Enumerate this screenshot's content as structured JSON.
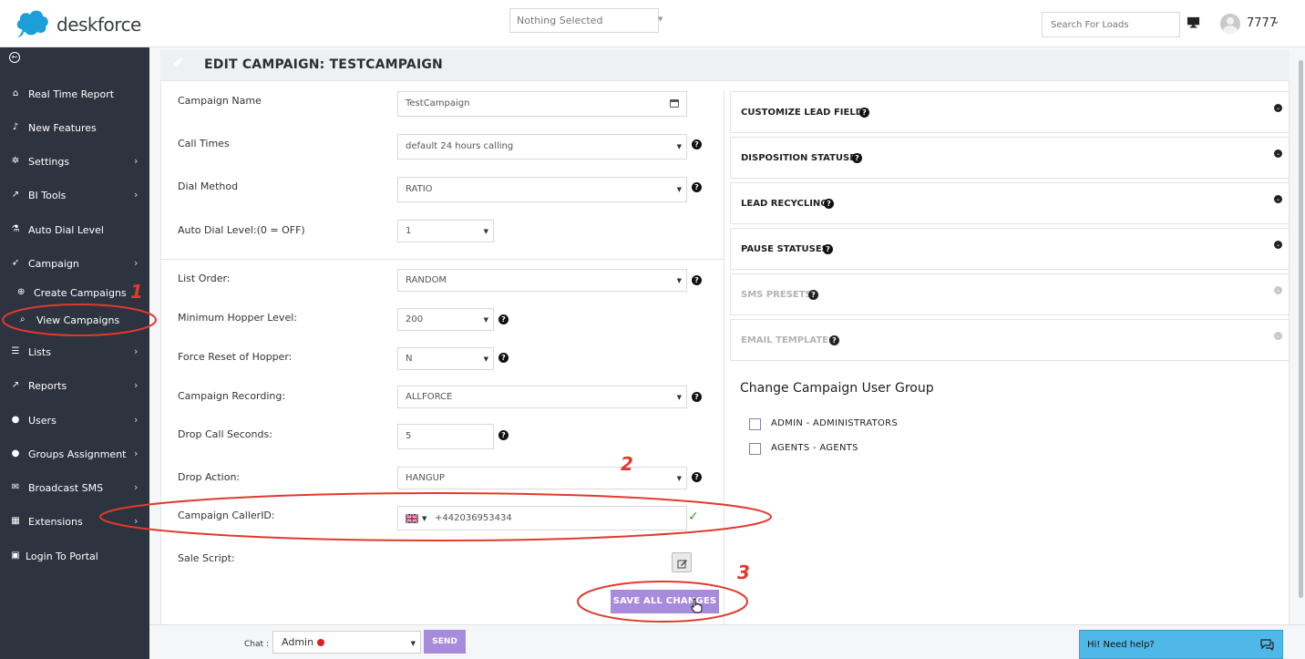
{
  "app": {
    "logo_text": "deskforce"
  },
  "header": {
    "campaign_select": "Nothing Selected",
    "search_placeholder": "Search For Loads",
    "user_name": "7777"
  },
  "sidebar": {
    "items": [
      {
        "label": "Real Time Report",
        "icon": "home-icon"
      },
      {
        "label": "New Features",
        "icon": "bell-icon"
      },
      {
        "label": "Settings",
        "icon": "gear-icon"
      },
      {
        "label": "BI Tools",
        "icon": "chart-line-icon"
      },
      {
        "label": "Auto Dial Level",
        "icon": "flask-icon"
      },
      {
        "label": "Campaign",
        "icon": "rocket-icon"
      },
      {
        "label": "Lists",
        "icon": "list-icon"
      },
      {
        "label": "Reports",
        "icon": "chart-line-icon"
      },
      {
        "label": "Users",
        "icon": "user-icon"
      },
      {
        "label": "Groups Assignment",
        "icon": "users-icon"
      },
      {
        "label": "Broadcast SMS",
        "icon": "envelope-icon"
      },
      {
        "label": "Extensions",
        "icon": "building-icon"
      },
      {
        "label": "Login To Portal",
        "icon": "lock-icon"
      }
    ],
    "sub_items": [
      {
        "label": "Create Campaigns",
        "icon": "plus-circle-icon"
      },
      {
        "label": "View Campaigns",
        "icon": "search-icon"
      }
    ]
  },
  "page": {
    "title": "EDIT CAMPAIGN: TESTCAMPAIGN"
  },
  "form": {
    "campaign_name": {
      "label": "Campaign Name",
      "value": "TestCampaign"
    },
    "call_times": {
      "label": "Call Times",
      "value": "default 24 hours calling"
    },
    "dial_method": {
      "label": "Dial Method",
      "value": "RATIO"
    },
    "auto_dial_level": {
      "label": "Auto Dial Level:(0 = OFF)",
      "value": "1"
    },
    "list_order": {
      "label": "List Order:",
      "value": "RANDOM"
    },
    "min_hopper": {
      "label": "Minimum Hopper Level:",
      "value": "200"
    },
    "force_reset": {
      "label": "Force Reset of Hopper:",
      "value": "N"
    },
    "recording": {
      "label": "Campaign Recording:",
      "value": "ALLFORCE"
    },
    "drop_seconds": {
      "label": "Drop Call Seconds:",
      "value": "5"
    },
    "drop_action": {
      "label": "Drop Action:",
      "value": "HANGUP"
    },
    "caller_id": {
      "label": "Campaign CallerID:",
      "value": "+442036953434"
    },
    "sale_script": {
      "label": "Sale Script:"
    },
    "save_label": "SAVE ALL CHANGES"
  },
  "accordions": [
    {
      "label": "CUSTOMIZE LEAD FIELDS",
      "enabled": true
    },
    {
      "label": "DISPOSITION STATUSES",
      "enabled": true
    },
    {
      "label": "LEAD RECYCLING",
      "enabled": true
    },
    {
      "label": "PAUSE STATUSES",
      "enabled": true
    },
    {
      "label": "SMS PRESETS",
      "enabled": false
    },
    {
      "label": "EMAIL TEMPLATES",
      "enabled": false
    }
  ],
  "user_group": {
    "title": "Change Campaign User Group",
    "options": [
      {
        "label": "ADMIN - ADMINISTRATORS",
        "checked": false
      },
      {
        "label": "AGENTS - AGENTS",
        "checked": false
      }
    ]
  },
  "chat": {
    "label": "Chat :",
    "selected": "Admin",
    "send_label": "SEND",
    "help_text": "Hi! Need help?"
  },
  "annotations": [
    "1",
    "2",
    "3"
  ],
  "colors": {
    "sidebar_bg": "#2d3440",
    "accent": "#a78bdd",
    "annotation": "#e03a2e",
    "help_widget": "#4fb8e8"
  }
}
